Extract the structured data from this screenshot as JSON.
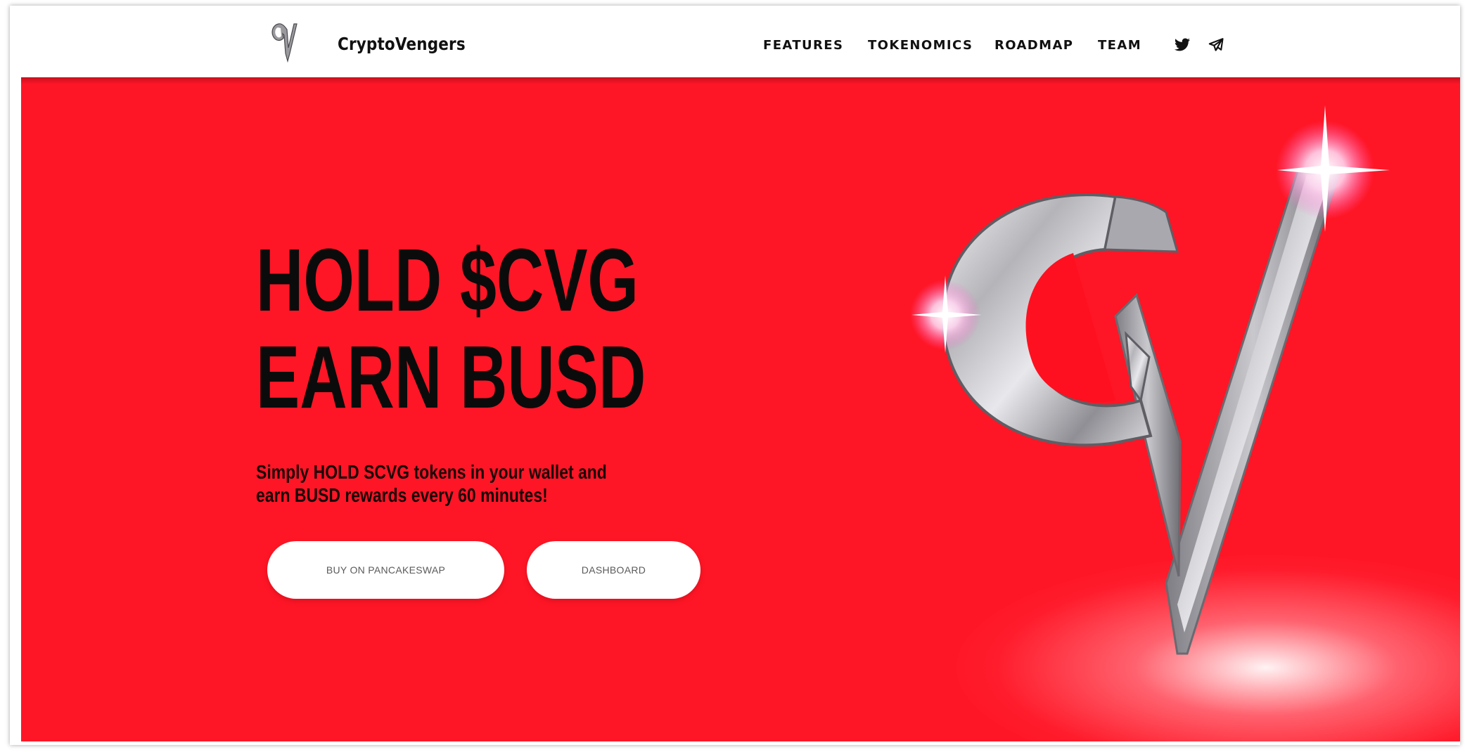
{
  "nav": {
    "brand": "CryptoVengers",
    "links": [
      "FEATURES",
      "TOKENOMICS",
      "ROADMAP",
      "TEAM"
    ],
    "social_icons": [
      "twitter-icon",
      "telegram-icon"
    ]
  },
  "hero": {
    "headline_line1": "HOLD $CVG",
    "headline_line2": "EARN BUSD",
    "sub_line1": "Simply HOLD SCVG tokens in your wallet and",
    "sub_line2": "earn BUSD rewards every 60 minutes!",
    "buttons": {
      "buy": "BUY ON PANCAKESWAP",
      "dashboard": "DASHBOARD"
    }
  },
  "colors": {
    "hero_background": "#ff1626",
    "text_dark": "#0b0b0b",
    "button_background": "#ffffff",
    "logo_silver": "#c9c9cd"
  }
}
